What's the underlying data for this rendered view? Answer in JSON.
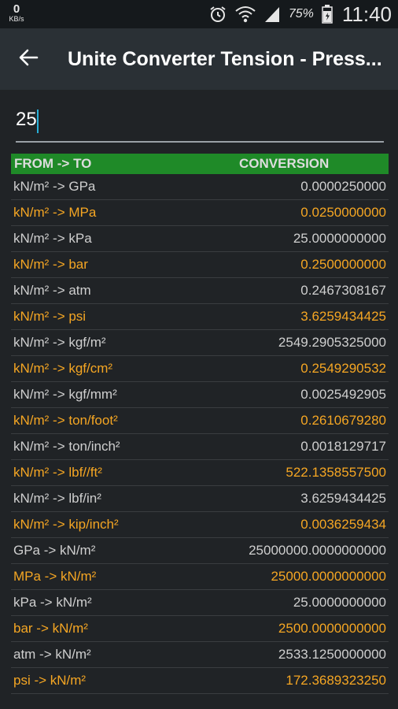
{
  "status_bar": {
    "net_speed_value": "0",
    "net_speed_unit": "KB/s",
    "battery_percent": "75%",
    "time": "11:40",
    "icons": [
      "alarm-icon",
      "wifi-icon",
      "signal-icon",
      "battery-icon"
    ]
  },
  "app_bar": {
    "title": "Unite Converter Tension - Press..."
  },
  "input": {
    "value": "25"
  },
  "table": {
    "header_from": "FROM -> TO",
    "header_conversion": "CONVERSION",
    "rows": [
      {
        "from": "kN/m² -> GPa",
        "conversion": "0.0000250000"
      },
      {
        "from": "kN/m² -> MPa",
        "conversion": "0.0250000000"
      },
      {
        "from": "kN/m² -> kPa",
        "conversion": "25.0000000000"
      },
      {
        "from": "kN/m² -> bar",
        "conversion": "0.2500000000"
      },
      {
        "from": "kN/m² -> atm",
        "conversion": "0.2467308167"
      },
      {
        "from": "kN/m² -> psi",
        "conversion": "3.6259434425"
      },
      {
        "from": "kN/m² -> kgf/m²",
        "conversion": "2549.2905325000"
      },
      {
        "from": "kN/m² -> kgf/cm²",
        "conversion": "0.2549290532"
      },
      {
        "from": "kN/m² -> kgf/mm²",
        "conversion": "0.0025492905"
      },
      {
        "from": "kN/m² -> ton/foot²",
        "conversion": "0.2610679280"
      },
      {
        "from": "kN/m² -> ton/inch²",
        "conversion": "0.0018129717"
      },
      {
        "from": "kN/m² -> lbf//ft²",
        "conversion": "522.1358557500"
      },
      {
        "from": "kN/m² -> lbf/in²",
        "conversion": "3.6259434425"
      },
      {
        "from": "kN/m² -> kip/inch²",
        "conversion": "0.0036259434"
      },
      {
        "from": "GPa -> kN/m²",
        "conversion": "25000000.0000000000"
      },
      {
        "from": "MPa -> kN/m²",
        "conversion": "25000.0000000000"
      },
      {
        "from": "kPa -> kN/m²",
        "conversion": "25.0000000000"
      },
      {
        "from": "bar -> kN/m²",
        "conversion": "2500.0000000000"
      },
      {
        "from": "atm -> kN/m²",
        "conversion": "2533.1250000000"
      },
      {
        "from": "psi -> kN/m²",
        "conversion": "172.3689323250"
      }
    ]
  },
  "colors": {
    "header_green": "#1f8a28",
    "accent_orange": "#f5a623",
    "text_light": "#cfcfcf",
    "background": "#202326",
    "app_bar": "#2a3035"
  }
}
